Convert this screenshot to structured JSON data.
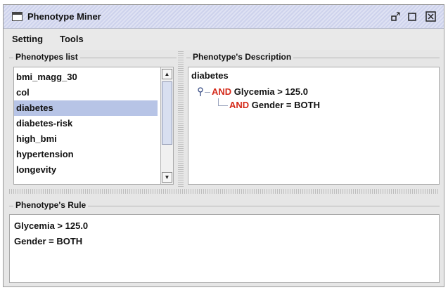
{
  "window": {
    "title": "Phenotype Miner"
  },
  "menubar": {
    "items": [
      "Setting",
      "Tools"
    ]
  },
  "phenotypes_list": {
    "title": "Phenotypes list",
    "items": [
      "bmi_magg_30",
      "col",
      "diabetes",
      "diabetes-risk",
      "high_bmi",
      "hypertension",
      "longevity"
    ],
    "selected": "diabetes"
  },
  "description": {
    "title": "Phenotype's Description",
    "root": "diabetes",
    "nodes": [
      {
        "op": "AND",
        "text": "Glycemia > 125.0"
      },
      {
        "op": "AND",
        "text": "Gender = BOTH"
      }
    ],
    "op_color": "#d42a1a"
  },
  "rule": {
    "title": "Phenotype's Rule",
    "lines": [
      "Glycemia > 125.0",
      "Gender = BOTH"
    ]
  },
  "icons": [
    "window-icon",
    "minimize-icon",
    "maximize-icon",
    "close-icon",
    "scroll-up-icon",
    "scroll-down-icon",
    "tree-handle-icon"
  ],
  "colors": {
    "selection": "#b7c4e6",
    "titlebar": "#cdd2ec"
  }
}
